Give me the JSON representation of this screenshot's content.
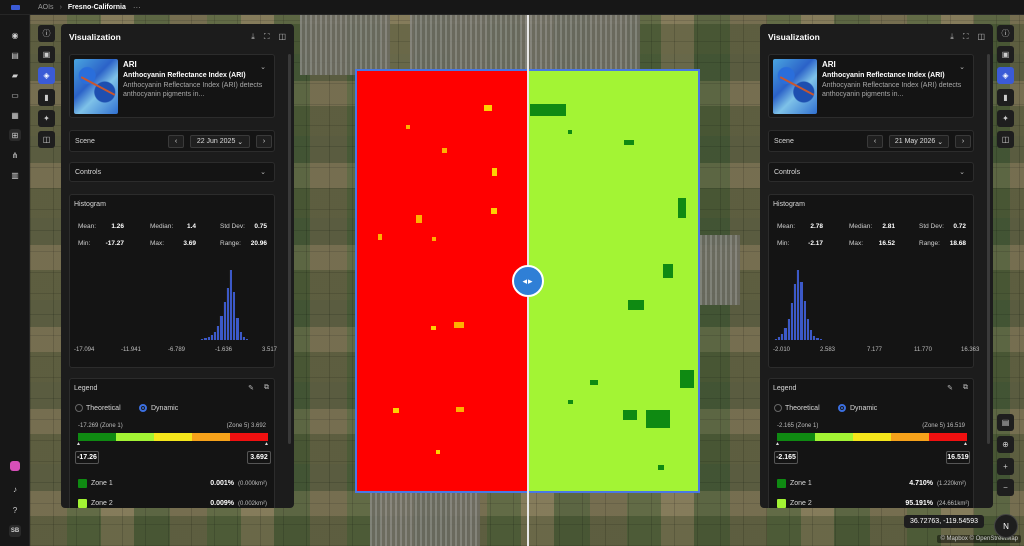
{
  "breadcrumb": {
    "root": "AOIs",
    "current": "Fresno-California",
    "more": "···"
  },
  "colors": {
    "accent": "#3b5bd6",
    "overlay_left": "#ff0000",
    "overlay_right": "#a3f434",
    "zone1": "#0f8a12",
    "zone2": "#a3f434"
  },
  "panels": [
    {
      "title": "Visualization",
      "index_short": "ARI",
      "index_full": "Anthocyanin Reflectance Index (ARI)",
      "index_desc": "Anthocyanin Reflectance Index (ARI) detects anthocyanin pigments in...",
      "scene_label": "Scene",
      "scene_date": "22 Jun 2025",
      "controls_label": "Controls",
      "histogram_label": "Histogram",
      "stats": {
        "mean_label": "Mean:",
        "mean": "1.26",
        "median_label": "Median:",
        "median": "1.4",
        "std_label": "Std Dev:",
        "std": "0.75",
        "min_label": "Min:",
        "min": "-17.27",
        "max_label": "Max:",
        "max": "3.69",
        "range_label": "Range:",
        "range": "20.96"
      },
      "hist_ticks": [
        "-17.094",
        "-11.941",
        "-6.789",
        "-1.636",
        "3.517"
      ],
      "hist_values": [
        1,
        2,
        3,
        5,
        8,
        14,
        24,
        38,
        52,
        70,
        48,
        22,
        8,
        3,
        1
      ],
      "hist_offset": 0.78,
      "legend_label": "Legend",
      "mode_theoretical": "Theoretical",
      "mode_dynamic": "Dynamic",
      "zone_low": "-17.269 (Zone 1)",
      "zone_high": "(Zone 5) 3.692",
      "input_min": "-17.26",
      "input_max": "3.692",
      "zones": [
        {
          "name": "Zone 1",
          "pct": "0.001%",
          "area": "(0.000km²)"
        },
        {
          "name": "Zone 2",
          "pct": "0.009%",
          "area": "(0.002km²)"
        }
      ]
    },
    {
      "title": "Visualization",
      "index_short": "ARI",
      "index_full": "Anthocyanin Reflectance Index (ARI)",
      "index_desc": "Anthocyanin Reflectance Index (ARI) detects anthocyanin pigments in...",
      "scene_label": "Scene",
      "scene_date": "21 May 2026",
      "controls_label": "Controls",
      "histogram_label": "Histogram",
      "stats": {
        "mean_label": "Mean:",
        "mean": "2.78",
        "median_label": "Median:",
        "median": "2.81",
        "std_label": "Std Dev:",
        "std": "0.72",
        "min_label": "Min:",
        "min": "-2.17",
        "max_label": "Max:",
        "max": "16.52",
        "range_label": "Range:",
        "range": "18.68"
      },
      "hist_ticks": [
        "-2.010",
        "2.583",
        "7.177",
        "11.770",
        "16.363"
      ],
      "hist_values": [
        1,
        3,
        6,
        12,
        22,
        38,
        58,
        72,
        60,
        40,
        22,
        10,
        4,
        2,
        1
      ],
      "hist_offset": 0.12,
      "legend_label": "Legend",
      "mode_theoretical": "Theoretical",
      "mode_dynamic": "Dynamic",
      "zone_low": "-2.165 (Zone 1)",
      "zone_high": "(Zone 5) 16.519",
      "input_min": "-2.165",
      "input_max": "16.519",
      "zones": [
        {
          "name": "Zone 1",
          "pct": "4.710%",
          "area": "(1.220km²)"
        },
        {
          "name": "Zone 2",
          "pct": "95.191%",
          "area": "(24.661km²)"
        }
      ]
    }
  ],
  "coordinates": "36.72763, -119.54593",
  "attribution": "© Mapbox © OpenStreetMap",
  "compass": "N",
  "user_initials": "SB"
}
